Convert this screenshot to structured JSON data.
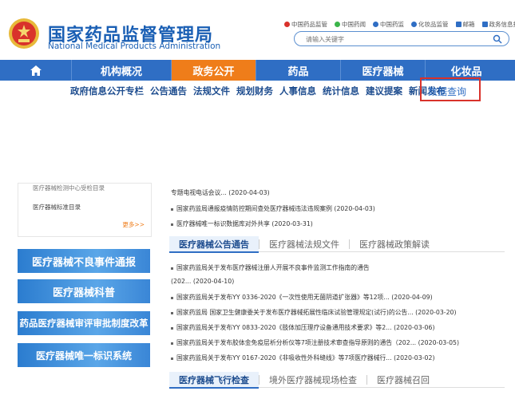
{
  "header": {
    "title": "国家药品监督管理局",
    "subtitle": "National Medical Products Administration",
    "toplinks": [
      {
        "label": "中国药品监管",
        "icon": "weibo-icon",
        "color": "#d9322b"
      },
      {
        "label": "中国药闻",
        "icon": "wechat-icon",
        "color": "#3bb54a"
      },
      {
        "label": "中国药监",
        "icon": "app-icon",
        "color": "#2f6ec4"
      },
      {
        "label": "化妆品监管",
        "icon": "app-icon",
        "color": "#2f6ec4"
      },
      {
        "label": "邮箱",
        "icon": "mail-icon",
        "color": "#2f6ec4"
      },
      {
        "label": "政务信息报送",
        "icon": "report-icon",
        "color": "#2f6ec4"
      }
    ],
    "search_placeholder": "请输入关键字"
  },
  "nav": {
    "items": [
      "机构概况",
      "政务公开",
      "药品",
      "医疗器械",
      "化妆品"
    ],
    "active": "政务公开"
  },
  "subnav": {
    "items": [
      "政府信息公开专栏",
      "公告通告",
      "法规文件",
      "规划财务",
      "人事信息",
      "统计信息",
      "建议提案",
      "新闻发布"
    ],
    "highlighted": "数据查询"
  },
  "left": {
    "list": [
      "医疗器械检测中心受检目录",
      "医疗器械标准目录"
    ],
    "more": "更多>>",
    "banners": [
      "医疗器械不良事件通报",
      "医疗器械科普",
      "药品医疗器械审评审批制度改革",
      "医疗器械唯一标识系统"
    ]
  },
  "news_top": [
    "专题电视电话会议... (2020-04-03)",
    "国家药监局通报疫情防控期间查处医疗器械违法违规案例 (2020-04-03)",
    "医疗器械唯一标识数据库对外共享 (2020-03-31)"
  ],
  "tabs1": [
    "医疗器械公告通告",
    "医疗器械法规文件",
    "医疗器械政策解读"
  ],
  "news_main": [
    "国家药监局关于发布医疗器械注册人开展不良事件监测工作指南的通告",
    "(202... (2020-04-10)",
    "国家药监局关于发布YY 0336-2020《一次性使用无菌阴道扩张器》等12项... (2020-04-09)",
    "国家药监局 国家卫生健康委关于发布医疗器械拓展性临床试验管理规定(试行)的公告... (2020-03-20)",
    "国家药监局关于发布YY 0833-2020《肢体加压理疗设备通用技术要求》等2... (2020-03-06)",
    "国家药监局关于发布胶体金免疫层析分析仪等7项注册技术审查指导原则的通告（202... (2020-03-05)",
    "国家药监局关于发布YY 0167-2020《非吸收性外科缝线》等7项医疗器械行... (2020-03-02)"
  ],
  "tabs2": [
    "医疗器械飞行检查",
    "境外医疗器械现场检查",
    "医疗器械召回"
  ]
}
